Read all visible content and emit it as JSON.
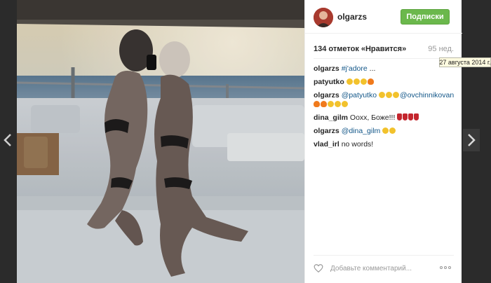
{
  "post": {
    "username": "olgarzs",
    "follow_label": "Подписки",
    "likes_text": "134 отметок «Нравится»",
    "age_text": "95 нед.",
    "date_tooltip": "27 августа 2014 г."
  },
  "comments": [
    {
      "user": "olgarzs",
      "tag": "#j'adore",
      "text": " ..."
    },
    {
      "user": "patyutko",
      "emojis": [
        "e-yellow",
        "e-yellow",
        "e-yellow",
        "e-fire"
      ]
    },
    {
      "user": "olgarzs",
      "tag": "@patyutko",
      "tag2": "@ovchinnikovan",
      "emojis": [
        "e-yellow",
        "e-yellow",
        "e-yellow"
      ],
      "emojis2": [
        "e-fire",
        "e-fire",
        "e-yellow",
        "e-yellow",
        "e-yellow"
      ]
    },
    {
      "user": "dina_gilm",
      "text": " Оохх, Боже!!! ",
      "emojis": [
        "e-dress",
        "e-dress",
        "e-dress",
        "e-dress"
      ]
    },
    {
      "user": "olgarzs",
      "tag": "@dina_gilm",
      "emojis": [
        "e-yellow",
        "e-yellow"
      ]
    },
    {
      "user": "vlad_irl",
      "text": " no words!"
    }
  ],
  "footer": {
    "comment_placeholder": "Добавьте комментарий..."
  },
  "icons": {
    "nav_prev": "chevron-left-icon",
    "nav_next": "chevron-right-icon",
    "like": "heart-icon",
    "more": "more-options-icon"
  },
  "colors": {
    "follow_button": "#6bb84c",
    "link": "#125688",
    "background": "#2b2b2b"
  }
}
